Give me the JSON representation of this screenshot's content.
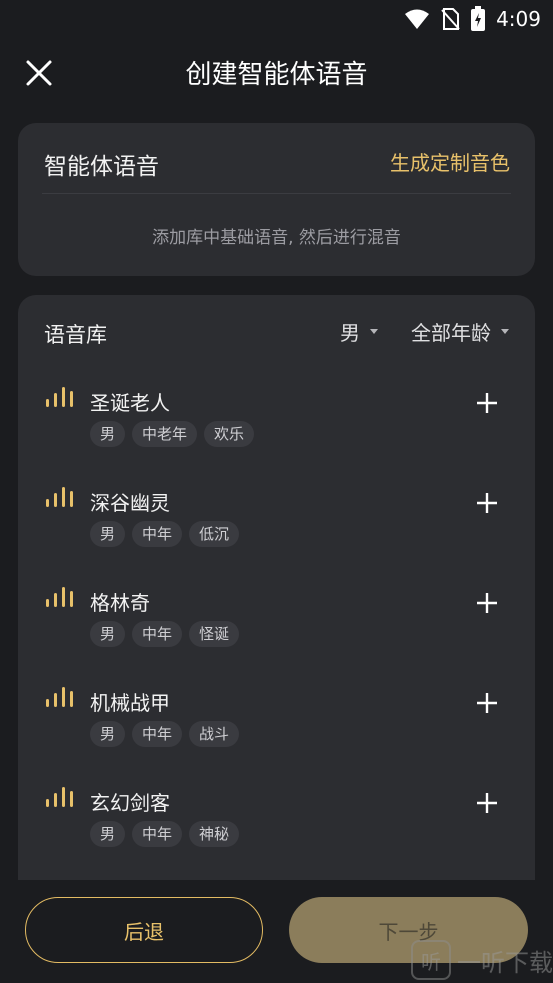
{
  "status_bar": {
    "time": "4:09"
  },
  "header": {
    "title": "创建智能体语音"
  },
  "agent_voice_card": {
    "title": "智能体语音",
    "action_label": "生成定制音色",
    "hint": "添加库中基础语音, 然后进行混音"
  },
  "voice_library": {
    "title": "语音库",
    "filter_gender": "男",
    "filter_age": "全部年龄",
    "items": [
      {
        "name": "圣诞老人",
        "tags": [
          "男",
          "中老年",
          "欢乐"
        ]
      },
      {
        "name": "深谷幽灵",
        "tags": [
          "男",
          "中年",
          "低沉"
        ]
      },
      {
        "name": "格林奇",
        "tags": [
          "男",
          "中年",
          "怪诞"
        ]
      },
      {
        "name": "机械战甲",
        "tags": [
          "男",
          "中年",
          "战斗"
        ]
      },
      {
        "name": "玄幻剑客",
        "tags": [
          "男",
          "中年",
          "神秘"
        ]
      }
    ]
  },
  "footer": {
    "back_label": "后退",
    "next_label": "下一步"
  },
  "watermark": {
    "logo": "听",
    "text": "一听下载"
  },
  "colors": {
    "accent": "#e8c16a",
    "background": "#1b1c1f",
    "card": "#2c2d31"
  }
}
